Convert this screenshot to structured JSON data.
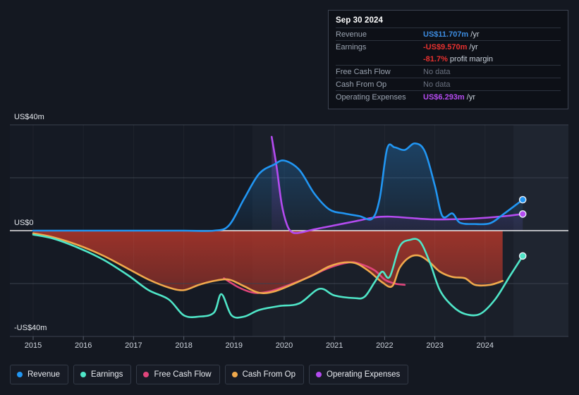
{
  "tooltip": {
    "title": "Sep 30 2024",
    "rows": [
      {
        "label": "Revenue",
        "value": "US$11.707m",
        "unit": "/yr",
        "style": "revenue"
      },
      {
        "label": "Earnings",
        "value": "-US$9.570m",
        "unit": "/yr",
        "style": "earnings"
      },
      {
        "label": "",
        "value": "-81.7%",
        "unit": "profit margin",
        "style": "earnings"
      },
      {
        "label": "Free Cash Flow",
        "value": "No data",
        "unit": "",
        "style": "nodata"
      },
      {
        "label": "Cash From Op",
        "value": "No data",
        "unit": "",
        "style": "nodata"
      },
      {
        "label": "Operating Expenses",
        "value": "US$6.293m",
        "unit": "/yr",
        "style": "opex"
      }
    ]
  },
  "legend": [
    {
      "label": "Revenue",
      "color": "#2196f3"
    },
    {
      "label": "Earnings",
      "color": "#4fe6c8"
    },
    {
      "label": "Free Cash Flow",
      "color": "#e0457b"
    },
    {
      "label": "Cash From Op",
      "color": "#f0a94c"
    },
    {
      "label": "Operating Expenses",
      "color": "#b44bf0"
    }
  ],
  "chart_data": {
    "type": "line",
    "title": "",
    "xlabel": "",
    "ylabel": "",
    "ylim": [
      -40,
      40
    ],
    "ytick_labels": [
      "US$40m",
      "US$0",
      "-US$40m"
    ],
    "ytick_values": [
      40,
      0,
      -40
    ],
    "gridlines": [
      40,
      20,
      0,
      -20
    ],
    "xtick_labels": [
      "2015",
      "2016",
      "2017",
      "2018",
      "2019",
      "2020",
      "2021",
      "2022",
      "2023",
      "2024"
    ],
    "x": [
      2015,
      2016,
      2017,
      2018,
      2019,
      2020,
      2021,
      2022,
      2023,
      2024
    ],
    "currency": "US$",
    "units": "millions",
    "grid": true,
    "legend_position": "bottom",
    "series": [
      {
        "name": "Revenue",
        "color": "#2196f3",
        "points": [
          [
            2015.0,
            0.0
          ],
          [
            2016.0,
            0.0
          ],
          [
            2017.0,
            0.0
          ],
          [
            2018.0,
            0.0
          ],
          [
            2018.6,
            0.0
          ],
          [
            2018.9,
            2.0
          ],
          [
            2019.2,
            12.0
          ],
          [
            2019.5,
            21.5
          ],
          [
            2019.8,
            25.0
          ],
          [
            2020.0,
            26.5
          ],
          [
            2020.3,
            23.0
          ],
          [
            2020.6,
            14.0
          ],
          [
            2020.9,
            8.0
          ],
          [
            2021.2,
            6.5
          ],
          [
            2021.5,
            5.5
          ],
          [
            2021.75,
            4.5
          ],
          [
            2021.9,
            12.0
          ],
          [
            2022.05,
            31.0
          ],
          [
            2022.2,
            31.5
          ],
          [
            2022.4,
            30.5
          ],
          [
            2022.6,
            33.0
          ],
          [
            2022.8,
            30.0
          ],
          [
            2023.0,
            17.0
          ],
          [
            2023.15,
            5.5
          ],
          [
            2023.35,
            6.5
          ],
          [
            2023.5,
            3.0
          ],
          [
            2023.8,
            2.5
          ],
          [
            2024.1,
            2.8
          ],
          [
            2024.35,
            6.0
          ],
          [
            2024.75,
            11.7
          ]
        ]
      },
      {
        "name": "Earnings",
        "color": "#4fe6c8",
        "points": [
          [
            2015.0,
            -1.5
          ],
          [
            2015.4,
            -3.0
          ],
          [
            2015.9,
            -6.5
          ],
          [
            2016.4,
            -11.0
          ],
          [
            2016.9,
            -17.0
          ],
          [
            2017.3,
            -22.5
          ],
          [
            2017.7,
            -26.0
          ],
          [
            2018.0,
            -32.0
          ],
          [
            2018.3,
            -32.5
          ],
          [
            2018.6,
            -31.0
          ],
          [
            2018.75,
            -24.0
          ],
          [
            2018.95,
            -32.0
          ],
          [
            2019.2,
            -32.5
          ],
          [
            2019.5,
            -30.0
          ],
          [
            2019.9,
            -28.5
          ],
          [
            2020.3,
            -27.5
          ],
          [
            2020.7,
            -22.0
          ],
          [
            2021.0,
            -24.5
          ],
          [
            2021.4,
            -25.5
          ],
          [
            2021.6,
            -25.0
          ],
          [
            2021.8,
            -19.5
          ],
          [
            2021.95,
            -15.5
          ],
          [
            2022.1,
            -17.5
          ],
          [
            2022.3,
            -6.0
          ],
          [
            2022.5,
            -3.5
          ],
          [
            2022.7,
            -4.0
          ],
          [
            2022.9,
            -12.0
          ],
          [
            2023.1,
            -22.5
          ],
          [
            2023.35,
            -28.5
          ],
          [
            2023.6,
            -31.5
          ],
          [
            2023.9,
            -31.5
          ],
          [
            2024.2,
            -26.0
          ],
          [
            2024.5,
            -17.0
          ],
          [
            2024.75,
            -9.6
          ]
        ]
      },
      {
        "name": "Free Cash Flow",
        "color": "#e0457b",
        "points": [
          [
            2018.8,
            -18.0
          ],
          [
            2019.1,
            -21.5
          ],
          [
            2019.4,
            -23.5
          ],
          [
            2019.7,
            -23.0
          ],
          [
            2020.1,
            -20.5
          ],
          [
            2020.5,
            -17.5
          ],
          [
            2020.9,
            -14.0
          ],
          [
            2021.3,
            -12.0
          ],
          [
            2021.5,
            -12.5
          ],
          [
            2021.8,
            -15.0
          ],
          [
            2022.0,
            -18.5
          ],
          [
            2022.2,
            -20.0
          ],
          [
            2022.4,
            -20.5
          ]
        ]
      },
      {
        "name": "Cash From Op",
        "color": "#f0a94c",
        "points": [
          [
            2015.0,
            -1.0
          ],
          [
            2015.4,
            -2.5
          ],
          [
            2015.9,
            -5.5
          ],
          [
            2016.4,
            -9.5
          ],
          [
            2016.9,
            -14.5
          ],
          [
            2017.3,
            -18.5
          ],
          [
            2017.7,
            -21.5
          ],
          [
            2018.0,
            -22.5
          ],
          [
            2018.3,
            -20.5
          ],
          [
            2018.6,
            -19.0
          ],
          [
            2018.9,
            -18.5
          ],
          [
            2019.2,
            -21.0
          ],
          [
            2019.5,
            -23.5
          ],
          [
            2019.8,
            -23.0
          ],
          [
            2020.2,
            -20.0
          ],
          [
            2020.6,
            -16.5
          ],
          [
            2020.9,
            -13.5
          ],
          [
            2021.2,
            -12.0
          ],
          [
            2021.45,
            -12.5
          ],
          [
            2021.7,
            -15.5
          ],
          [
            2021.95,
            -19.5
          ],
          [
            2022.15,
            -21.0
          ],
          [
            2022.3,
            -14.0
          ],
          [
            2022.5,
            -10.0
          ],
          [
            2022.7,
            -9.5
          ],
          [
            2022.9,
            -12.0
          ],
          [
            2023.1,
            -15.5
          ],
          [
            2023.35,
            -17.5
          ],
          [
            2023.6,
            -18.0
          ],
          [
            2023.8,
            -20.5
          ],
          [
            2024.1,
            -20.5
          ],
          [
            2024.35,
            -19.0
          ]
        ]
      },
      {
        "name": "Operating Expenses",
        "color": "#b44bf0",
        "points": [
          [
            2019.75,
            35.5
          ],
          [
            2019.85,
            24.0
          ],
          [
            2019.95,
            10.0
          ],
          [
            2020.05,
            2.5
          ],
          [
            2020.15,
            -0.5
          ],
          [
            2020.3,
            -0.8
          ],
          [
            2020.6,
            0.5
          ],
          [
            2021.0,
            2.0
          ],
          [
            2021.4,
            3.5
          ],
          [
            2021.8,
            5.0
          ],
          [
            2022.1,
            5.3
          ],
          [
            2022.5,
            4.8
          ],
          [
            2022.9,
            4.3
          ],
          [
            2023.3,
            4.3
          ],
          [
            2023.7,
            4.5
          ],
          [
            2024.1,
            5.0
          ],
          [
            2024.45,
            5.6
          ],
          [
            2024.75,
            6.29
          ]
        ]
      }
    ],
    "endpoints": [
      {
        "name": "Revenue",
        "x": 2024.75,
        "y": 11.7,
        "color": "#2196f3"
      },
      {
        "name": "Operating Expenses",
        "x": 2024.75,
        "y": 6.29,
        "color": "#b44bf0"
      },
      {
        "name": "Earnings",
        "x": 2024.75,
        "y": -9.57,
        "color": "#4fe6c8"
      }
    ]
  }
}
